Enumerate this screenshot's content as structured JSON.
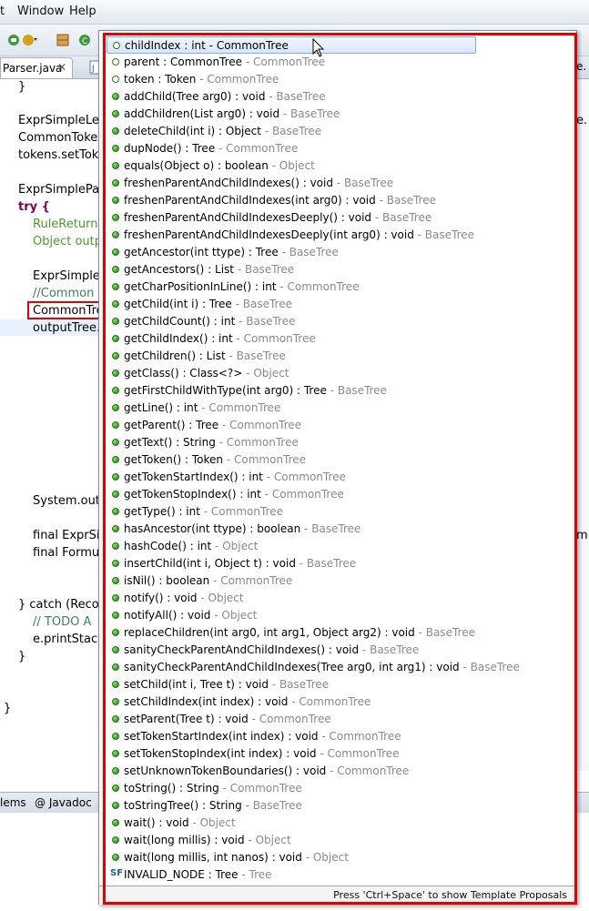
{
  "menubar": {
    "items": [
      "t",
      "Window",
      "Help"
    ]
  },
  "editor_tab": {
    "label": "Parser.java",
    "close": "✕"
  },
  "code": {
    "lines": [
      {
        "text": "}",
        "y": 0
      },
      {
        "text": "ExprSimpleLex",
        "y": 0
      },
      {
        "text": "CommonToke",
        "y": 0
      },
      {
        "text": "tokens.setToke",
        "y": 0
      },
      {
        "text": "ExprSimplePar",
        "y": 0
      },
      {
        "text": "try {",
        "y": 0
      },
      {
        "text": "RuleReturnS",
        "y": 0
      },
      {
        "text": "Object outp",
        "y": 0
      },
      {
        "text": "ExprSimpleI",
        "y": 0
      },
      {
        "text": "//Common",
        "y": 0
      },
      {
        "text": "CommonTre",
        "y": 0
      },
      {
        "text": "outputTree.",
        "y": 0
      },
      {
        "text": "System.out.",
        "y": 0
      },
      {
        "text": "final ExprSi",
        "y": 0
      },
      {
        "text": "final Formu",
        "y": 0
      },
      {
        "text": "} catch (Recog",
        "y": 0
      },
      {
        "text": "// TODO A",
        "y": 0
      },
      {
        "text": "e.printStack",
        "y": 0
      },
      {
        "text": "}",
        "y": 0
      },
      {
        "text": "}",
        "y": 0
      }
    ],
    "right_fragments": [
      "e.",
      "m"
    ]
  },
  "bottom_tabs": [
    "lems",
    "@ Javadoc"
  ],
  "popup": {
    "status": "Press 'Ctrl+Space' to show Template Proposals",
    "proposals": [
      {
        "sig": "childIndex : int",
        "decl": "CommonTree",
        "kind": "field",
        "selected": true
      },
      {
        "sig": "parent : CommonTree",
        "decl": "CommonTree",
        "kind": "field"
      },
      {
        "sig": "token : Token",
        "decl": "CommonTree",
        "kind": "field"
      },
      {
        "sig": "addChild(Tree arg0) : void",
        "decl": "BaseTree",
        "kind": "method"
      },
      {
        "sig": "addChildren(List arg0) : void",
        "decl": "BaseTree",
        "kind": "method"
      },
      {
        "sig": "deleteChild(int i) : Object",
        "decl": "BaseTree",
        "kind": "method"
      },
      {
        "sig": "dupNode() : Tree",
        "decl": "CommonTree",
        "kind": "method"
      },
      {
        "sig": "equals(Object o) : boolean",
        "decl": "Object",
        "kind": "method"
      },
      {
        "sig": "freshenParentAndChildIndexes() : void",
        "decl": "BaseTree",
        "kind": "method"
      },
      {
        "sig": "freshenParentAndChildIndexes(int arg0) : void",
        "decl": "BaseTree",
        "kind": "method"
      },
      {
        "sig": "freshenParentAndChildIndexesDeeply() : void",
        "decl": "BaseTree",
        "kind": "method"
      },
      {
        "sig": "freshenParentAndChildIndexesDeeply(int arg0) : void",
        "decl": "BaseTree",
        "kind": "method"
      },
      {
        "sig": "getAncestor(int ttype) : Tree",
        "decl": "BaseTree",
        "kind": "method"
      },
      {
        "sig": "getAncestors() : List",
        "decl": "BaseTree",
        "kind": "method"
      },
      {
        "sig": "getCharPositionInLine() : int",
        "decl": "CommonTree",
        "kind": "method"
      },
      {
        "sig": "getChild(int i) : Tree",
        "decl": "BaseTree",
        "kind": "method"
      },
      {
        "sig": "getChildCount() : int",
        "decl": "BaseTree",
        "kind": "method"
      },
      {
        "sig": "getChildIndex() : int",
        "decl": "CommonTree",
        "kind": "method"
      },
      {
        "sig": "getChildren() : List",
        "decl": "BaseTree",
        "kind": "method"
      },
      {
        "sig": "getClass() : Class<?>",
        "decl": "Object",
        "kind": "method"
      },
      {
        "sig": "getFirstChildWithType(int arg0) : Tree",
        "decl": "BaseTree",
        "kind": "method"
      },
      {
        "sig": "getLine() : int",
        "decl": "CommonTree",
        "kind": "method"
      },
      {
        "sig": "getParent() : Tree",
        "decl": "CommonTree",
        "kind": "method"
      },
      {
        "sig": "getText() : String",
        "decl": "CommonTree",
        "kind": "method"
      },
      {
        "sig": "getToken() : Token",
        "decl": "CommonTree",
        "kind": "method"
      },
      {
        "sig": "getTokenStartIndex() : int",
        "decl": "CommonTree",
        "kind": "method"
      },
      {
        "sig": "getTokenStopIndex() : int",
        "decl": "CommonTree",
        "kind": "method"
      },
      {
        "sig": "getType() : int",
        "decl": "CommonTree",
        "kind": "method"
      },
      {
        "sig": "hasAncestor(int ttype) : boolean",
        "decl": "BaseTree",
        "kind": "method"
      },
      {
        "sig": "hashCode() : int",
        "decl": "Object",
        "kind": "method"
      },
      {
        "sig": "insertChild(int i, Object t) : void",
        "decl": "BaseTree",
        "kind": "method"
      },
      {
        "sig": "isNil() : boolean",
        "decl": "CommonTree",
        "kind": "method"
      },
      {
        "sig": "notify() : void",
        "decl": "Object",
        "kind": "method"
      },
      {
        "sig": "notifyAll() : void",
        "decl": "Object",
        "kind": "method"
      },
      {
        "sig": "replaceChildren(int arg0, int arg1, Object arg2) : void",
        "decl": "BaseTree",
        "kind": "method"
      },
      {
        "sig": "sanityCheckParentAndChildIndexes() : void",
        "decl": "BaseTree",
        "kind": "method"
      },
      {
        "sig": "sanityCheckParentAndChildIndexes(Tree arg0, int arg1) : void",
        "decl": "BaseTree",
        "kind": "method"
      },
      {
        "sig": "setChild(int i, Tree t) : void",
        "decl": "BaseTree",
        "kind": "method"
      },
      {
        "sig": "setChildIndex(int index) : void",
        "decl": "CommonTree",
        "kind": "method"
      },
      {
        "sig": "setParent(Tree t) : void",
        "decl": "CommonTree",
        "kind": "method"
      },
      {
        "sig": "setTokenStartIndex(int index) : void",
        "decl": "CommonTree",
        "kind": "method"
      },
      {
        "sig": "setTokenStopIndex(int index) : void",
        "decl": "CommonTree",
        "kind": "method"
      },
      {
        "sig": "setUnknownTokenBoundaries() : void",
        "decl": "CommonTree",
        "kind": "method"
      },
      {
        "sig": "toString() : String",
        "decl": "CommonTree",
        "kind": "method"
      },
      {
        "sig": "toStringTree() : String",
        "decl": "BaseTree",
        "kind": "method"
      },
      {
        "sig": "wait() : void",
        "decl": "Object",
        "kind": "method"
      },
      {
        "sig": "wait(long millis) : void",
        "decl": "Object",
        "kind": "method"
      },
      {
        "sig": "wait(long millis, int nanos) : void",
        "decl": "Object",
        "kind": "method"
      },
      {
        "sig": "INVALID_NODE : Tree",
        "decl": "Tree",
        "kind": "static"
      }
    ]
  },
  "colors": {
    "highlight": "#e30000",
    "keyword": "#7f0055",
    "comment": "#3f7f5f",
    "method_icon": "#2f9a1d",
    "declaring_type": "#8a8a8a"
  }
}
